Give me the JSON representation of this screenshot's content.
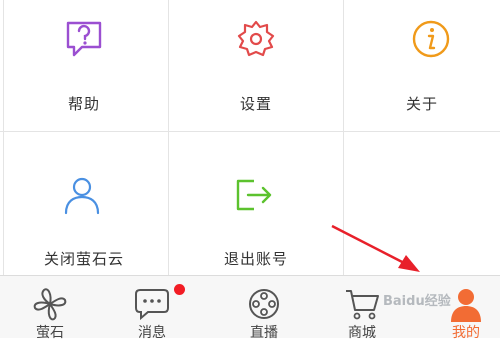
{
  "grid": {
    "items": [
      {
        "label": "帮助",
        "icon": "help-icon",
        "color": "#9b4fd1"
      },
      {
        "label": "设置",
        "icon": "gear-icon",
        "color": "#e24a4a"
      },
      {
        "label": "关于",
        "icon": "info-icon",
        "color": "#f09a1a"
      },
      {
        "label": "关闭萤石云",
        "icon": "user-icon",
        "color": "#4a90e2"
      },
      {
        "label": "退出账号",
        "icon": "logout-icon",
        "color": "#5cc22e"
      }
    ]
  },
  "tabbar": {
    "items": [
      {
        "label": "萤石",
        "icon": "fan-icon"
      },
      {
        "label": "消息",
        "icon": "message-icon",
        "badge": true
      },
      {
        "label": "直播",
        "icon": "film-reel-icon"
      },
      {
        "label": "商城",
        "icon": "cart-icon"
      },
      {
        "label": "我的",
        "icon": "profile-icon",
        "active": true
      }
    ],
    "active_color": "#f26c34",
    "badge_color": "#f21c24"
  },
  "annotation": {
    "color": "#e8202a",
    "watermark": "Baidu经验"
  }
}
